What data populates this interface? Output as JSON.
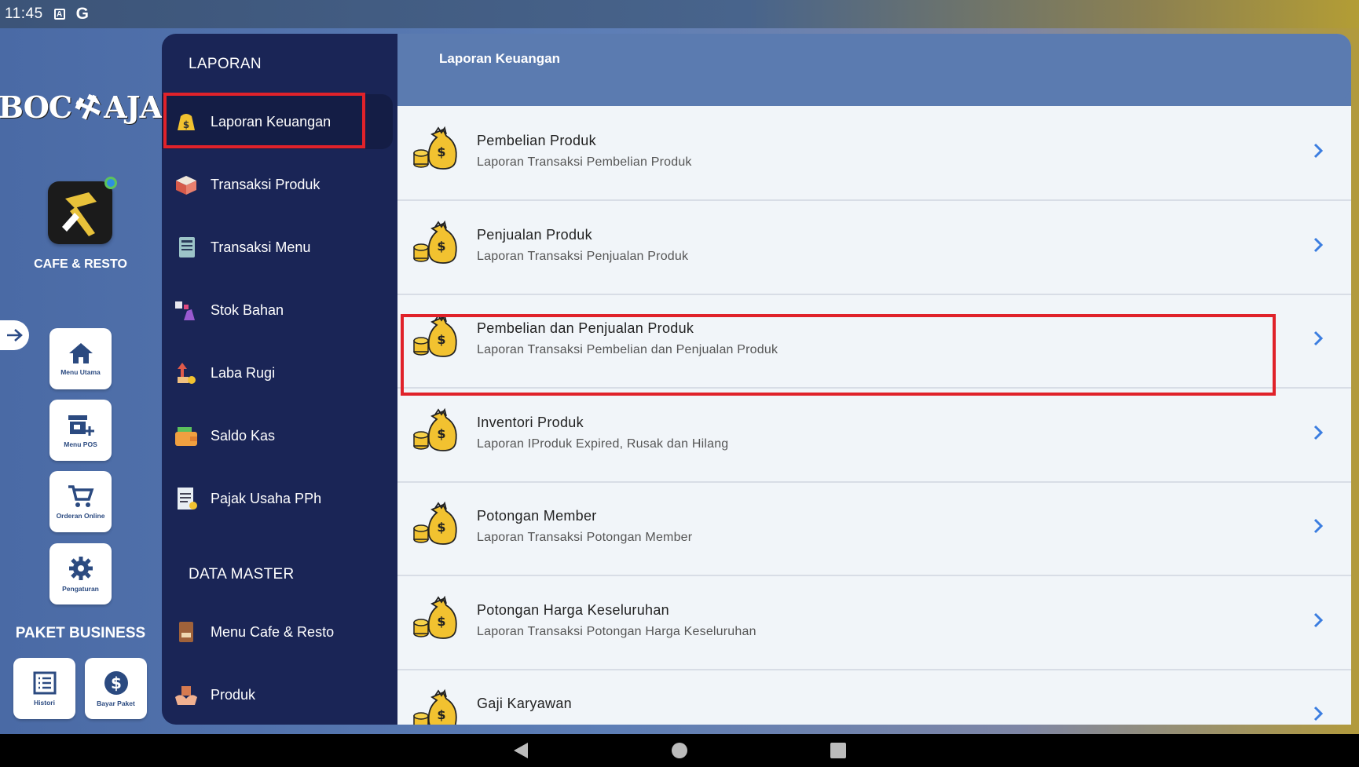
{
  "status_bar": {
    "time": "11:45",
    "icons": [
      "a-notification-icon",
      "google-icon"
    ]
  },
  "rail": {
    "brand": "CAFE & RESTO",
    "logo_text": "BOC AJA",
    "tiles": [
      {
        "label": "Menu Utama",
        "icon": "home-icon"
      },
      {
        "label": "Menu POS",
        "icon": "store-add-icon"
      },
      {
        "label": "Orderan Online",
        "icon": "cart-icon"
      },
      {
        "label": "Pengaturan",
        "icon": "gear-icon"
      }
    ],
    "paket_title": "PAKET BUSINESS",
    "paket_tiles": [
      {
        "label": "Histori",
        "icon": "list-icon"
      },
      {
        "label": "Bayar Paket",
        "icon": "dollar-icon"
      }
    ]
  },
  "nav": {
    "section1": "LAPORAN",
    "items": [
      {
        "label": "Laporan Keuangan",
        "icon": "money-bag-icon",
        "active": true
      },
      {
        "label": "Transaksi Produk",
        "icon": "box-icon"
      },
      {
        "label": "Transaksi Menu",
        "icon": "menu-board-icon"
      },
      {
        "label": "Stok Bahan",
        "icon": "stock-icon"
      },
      {
        "label": "Laba Rugi",
        "icon": "profit-icon"
      },
      {
        "label": "Saldo Kas",
        "icon": "wallet-icon"
      },
      {
        "label": "Pajak Usaha PPh",
        "icon": "tax-icon"
      }
    ],
    "section2": "DATA MASTER",
    "items2": [
      {
        "label": "Menu Cafe & Resto",
        "icon": "menu-book-icon"
      },
      {
        "label": "Produk",
        "icon": "product-icon"
      }
    ]
  },
  "content": {
    "title": "Laporan Keuangan",
    "rows": [
      {
        "title": "Pembelian Produk",
        "subtitle": "Laporan Transaksi Pembelian Produk"
      },
      {
        "title": "Penjualan Produk",
        "subtitle": "Laporan Transaksi Penjualan Produk"
      },
      {
        "title": "Pembelian dan Penjualan Produk",
        "subtitle": "Laporan Transaksi Pembelian dan Penjualan Produk"
      },
      {
        "title": "Inventori Produk",
        "subtitle": "Laporan IProduk Expired, Rusak dan Hilang"
      },
      {
        "title": "Potongan Member",
        "subtitle": "Laporan Transaksi Potongan Member"
      },
      {
        "title": "Potongan Harga Keseluruhan",
        "subtitle": "Laporan Transaksi Potongan Harga Keseluruhan"
      },
      {
        "title": "Gaji Karyawan",
        "subtitle": ""
      }
    ]
  },
  "colors": {
    "nav_bg": "#1a2556",
    "header_bg": "#5b7bb0",
    "highlight": "#e0222a",
    "chevron": "#3b7de0"
  }
}
